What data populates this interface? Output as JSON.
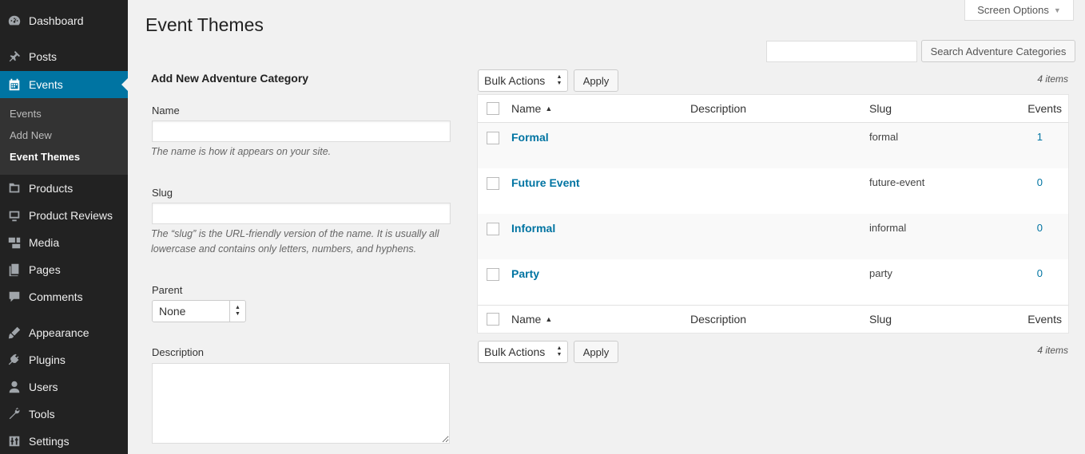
{
  "sidebar": {
    "items": [
      {
        "label": "Dashboard",
        "icon": "dashboard-icon"
      },
      {
        "label": "Posts",
        "icon": "pin-icon"
      },
      {
        "label": "Events",
        "icon": "calendar-icon"
      },
      {
        "label": "Products",
        "icon": "products-icon"
      },
      {
        "label": "Product Reviews",
        "icon": "reviews-icon"
      },
      {
        "label": "Media",
        "icon": "media-icon"
      },
      {
        "label": "Pages",
        "icon": "pages-icon"
      },
      {
        "label": "Comments",
        "icon": "comment-icon"
      },
      {
        "label": "Appearance",
        "icon": "brush-icon"
      },
      {
        "label": "Plugins",
        "icon": "plug-icon"
      },
      {
        "label": "Users",
        "icon": "user-icon"
      },
      {
        "label": "Tools",
        "icon": "wrench-icon"
      },
      {
        "label": "Settings",
        "icon": "settings-icon"
      }
    ],
    "submenu": [
      "Events",
      "Add New",
      "Event Themes"
    ],
    "active_color": "#0074a2"
  },
  "header": {
    "screen_options": "Screen Options",
    "title": "Event Themes"
  },
  "form": {
    "heading": "Add New Adventure Category",
    "name_label": "Name",
    "name_value": "",
    "name_help": "The name is how it appears on your site.",
    "slug_label": "Slug",
    "slug_value": "",
    "slug_help": "The “slug” is the URL-friendly version of the name. It is usually all lowercase and contains only letters, numbers, and hyphens.",
    "parent_label": "Parent",
    "parent_value": "None",
    "description_label": "Description",
    "description_value": ""
  },
  "search": {
    "value": "",
    "button": "Search Adventure Categories"
  },
  "bulk": {
    "label": "Bulk Actions",
    "apply": "Apply",
    "count": "4 items"
  },
  "table": {
    "columns": [
      "Name",
      "Description",
      "Slug",
      "Events"
    ],
    "rows": [
      {
        "name": "Formal",
        "description": "",
        "slug": "formal",
        "count": "1"
      },
      {
        "name": "Future Event",
        "description": "",
        "slug": "future-event",
        "count": "0"
      },
      {
        "name": "Informal",
        "description": "",
        "slug": "informal",
        "count": "0"
      },
      {
        "name": "Party",
        "description": "",
        "slug": "party",
        "count": "0"
      }
    ]
  }
}
